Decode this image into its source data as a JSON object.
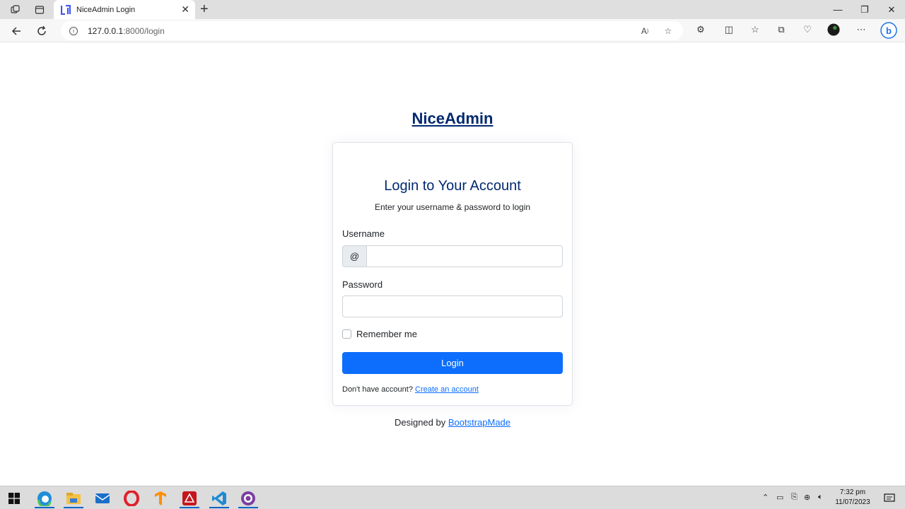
{
  "browser": {
    "tab_title": "NiceAdmin Login",
    "url_host": "127.0.0.1",
    "url_rest": ":8000/login",
    "new_tab": "+",
    "tab_close": "✕"
  },
  "page": {
    "brand": "NiceAdmin",
    "card_title": "Login to Your Account",
    "card_subtitle": "Enter your username & password to login",
    "username_label": "Username",
    "username_prefix": "@",
    "username_value": "",
    "password_label": "Password",
    "password_value": "",
    "remember_label": "Remember me",
    "login_button": "Login",
    "no_account_text": "Don't have account? ",
    "create_account_link": "Create an account",
    "designed_by": "Designed by ",
    "designer_link": "BootstrapMade"
  },
  "taskbar": {
    "time": "7:32 pm",
    "date": "11/07/2023"
  },
  "colors": {
    "brand": "#012970",
    "primary": "#0d6efd"
  }
}
